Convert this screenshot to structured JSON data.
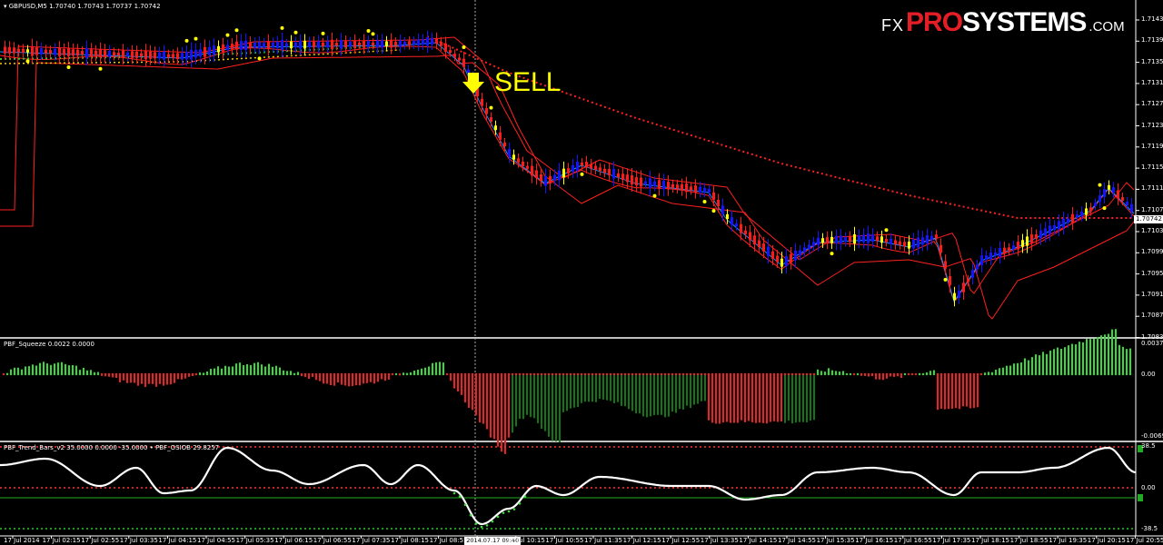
{
  "main": {
    "symbol_title": "GBPUSD,M5  1.70740 1.70743 1.70737 1.70742",
    "price_axis": [
      "1.71435",
      "1.71395",
      "1.71355",
      "1.71315",
      "1.71275",
      "1.71235",
      "1.71195",
      "1.71155",
      "1.71115",
      "1.71075",
      "1.71035",
      "1.70995",
      "1.70955",
      "1.70915",
      "1.70875",
      "1.70835"
    ],
    "current_price": "1.70742",
    "signal_label": "SELL",
    "colors": {
      "bull": "#1414ff",
      "bear": "#ff1a1a",
      "signal": "#ffff00",
      "ma_red": "#ff2020",
      "ma_blue": "#1e90ff",
      "dots_green": "#33cc33"
    }
  },
  "logo": {
    "fx": "FX",
    "pro": "PRO",
    "systems": "SYSTEMS",
    ".com": ".COM"
  },
  "squeeze": {
    "title": "PBF_Squeeze 0.0022 0.0000",
    "axis": [
      "0.0037",
      "0.00",
      "-0.0069"
    ]
  },
  "trend": {
    "title": "PBF_Trend_Bars_v2 35.0000 0.0000 -35.0000 • PBF_OSIOB 29.8257",
    "axis": [
      "38.5",
      "0.00",
      "-38.5"
    ]
  },
  "time_axis": [
    "17 Jul 2014",
    "17 Jul 02:15",
    "17 Jul 02:55",
    "17 Jul 03:35",
    "17 Jul 04:15",
    "17 Jul 04:55",
    "17 Jul 05:35",
    "17 Jul 06:15",
    "17 Jul 06:55",
    "17 Jul 07:35",
    "17 Jul 08:15",
    "17 Jul 08:55",
    "2014.07.17 09:40",
    "17 Jul 10:15",
    "17 Jul 10:55",
    "17 Jul 11:35",
    "17 Jul 12:15",
    "17 Jul 12:55",
    "17 Jul 13:35",
    "17 Jul 14:15",
    "17 Jul 14:55",
    "17 Jul 15:35",
    "17 Jul 16:15",
    "17 Jul 16:55",
    "17 Jul 17:35",
    "17 Jul 18:15",
    "17 Jul 18:55",
    "17 Jul 19:35",
    "17 Jul 20:15",
    "17 Jul 20:55"
  ],
  "cursor_time": "2014.07.17 09:40"
}
